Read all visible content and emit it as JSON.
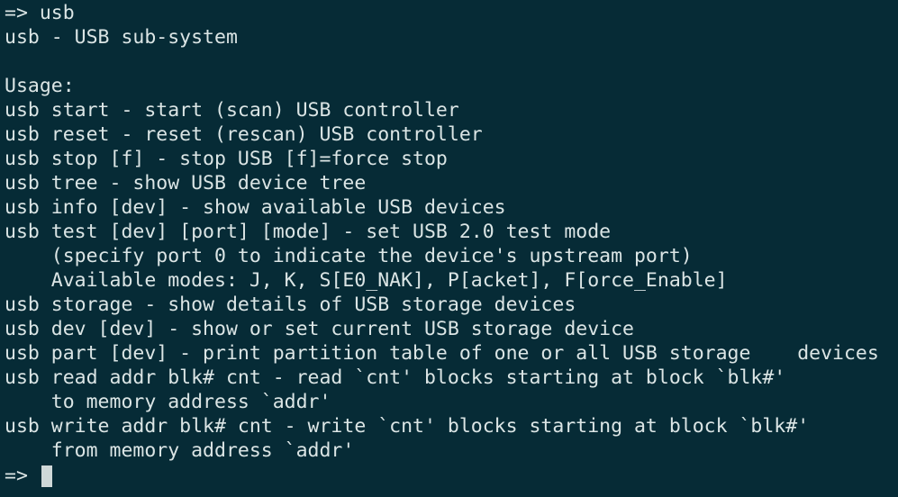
{
  "terminal": {
    "background": "#062b36",
    "foreground": "#dbe5e5",
    "cursor_color": "#cfd8d8",
    "lines": [
      "=> usb",
      "usb - USB sub-system",
      "",
      "Usage:",
      "usb start - start (scan) USB controller",
      "usb reset - reset (rescan) USB controller",
      "usb stop [f] - stop USB [f]=force stop",
      "usb tree - show USB device tree",
      "usb info [dev] - show available USB devices",
      "usb test [dev] [port] [mode] - set USB 2.0 test mode",
      "    (specify port 0 to indicate the device's upstream port)",
      "    Available modes: J, K, S[E0_NAK], P[acket], F[orce_Enable]",
      "usb storage - show details of USB storage devices",
      "usb dev [dev] - show or set current USB storage device",
      "usb part [dev] - print partition table of one or all USB storage    devices",
      "usb read addr blk# cnt - read `cnt' blocks starting at block `blk#'",
      "    to memory address `addr'",
      "usb write addr blk# cnt - write `cnt' blocks starting at block `blk#'",
      "    from memory address `addr'"
    ],
    "prompt": "=> "
  }
}
